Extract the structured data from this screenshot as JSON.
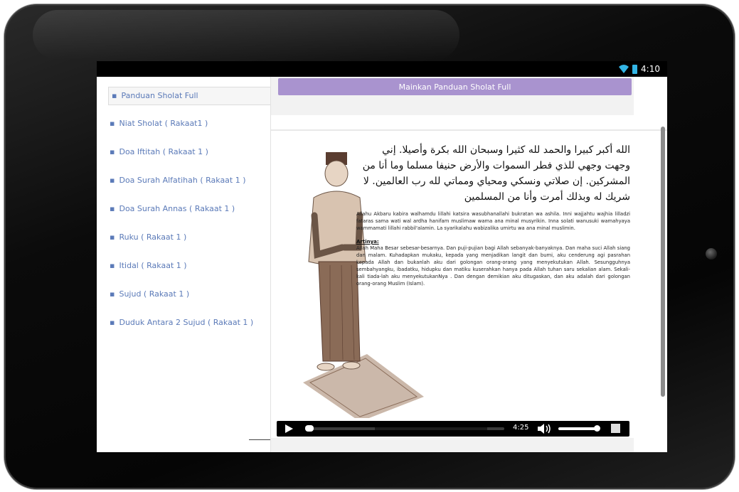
{
  "statusbar": {
    "time": "4:10"
  },
  "sidebar": {
    "items": [
      {
        "label": "Panduan Sholat Full",
        "active": true
      },
      {
        "label": "Niat Sholat ( Rakaat1 )"
      },
      {
        "label": "Doa Iftitah ( Rakaat 1 )"
      },
      {
        "label": "Doa Surah Alfatihah ( Rakaat 1 )"
      },
      {
        "label": "Doa Surah Annas ( Rakaat 1 )"
      },
      {
        "label": "Ruku ( Rakaat 1 )"
      },
      {
        "label": "Itidal ( Rakaat 1 )"
      },
      {
        "label": "Sujud ( Rakaat 1 )"
      },
      {
        "label": "Duduk Antara 2 Sujud ( Rakaat 1 )"
      }
    ]
  },
  "main": {
    "play_button_label": "Mainkan Panduan Sholat Full",
    "arabic_text": "الله أكبر كبيرا والحمد لله كثيرا وسبحان الله بكرة وأصيلا. إني وجهت وجهي للذي فطر السموات والأرض حنيفا مسلما وما أنا من المشركين. إن صلاتي ونسكي ومحياي ومماتي لله رب العالمين. لا شريك له وبذلك أمرت وأنا من المسلمين",
    "latin_text": "Allahu Akbaru kabira walhamdu lillahi katsira wasubhanallahi bukratan wa ashila. Inni wajjahtu wajhia lilladzi fataras sama wati wal ardha hanifam muslimaw wama ana minal musyrikin. Inna solati wanusuki wamahyaya wammamati lillahi rabbil'alamin. La syarikalahu wabizalika umirtu wa ana minal muslimin.",
    "artinya_heading": "Artinya:",
    "artinya_text": "Allah Maha Besar sebesar-besarnya. Dan puji-pujian bagi Allah sebanyak-banyaknya. Dan maha suci Allah siang dan malam. Kuhadapkan mukaku, kepada yang menjadikan langit dan bumi, aku cenderung agi pasrahan kepada Allah dan bukanlah aku dari golongan orang-orang yang menyekutukan Allah. Sesungguhnya sembahyangku, ibadatku, hidupku dan matiku kuserahkan hanya pada Allah tuhan saru sekalian alam. Sekali-kali tiada-lah aku menyekutukanNya . Dan dengan demikian aku ditugaskan, dan aku adalah dari golongan orang-orang Muslim (Islam)."
  },
  "player": {
    "time": "4:25",
    "progress": 0.02,
    "volume": 0.9
  },
  "colors": {
    "accent": "#a993cf",
    "link": "#5b7ab8",
    "battery": "#33b5e5"
  },
  "icons": [
    "wifi-icon",
    "battery-icon",
    "play-icon",
    "volume-icon",
    "fullscreen-icon"
  ]
}
